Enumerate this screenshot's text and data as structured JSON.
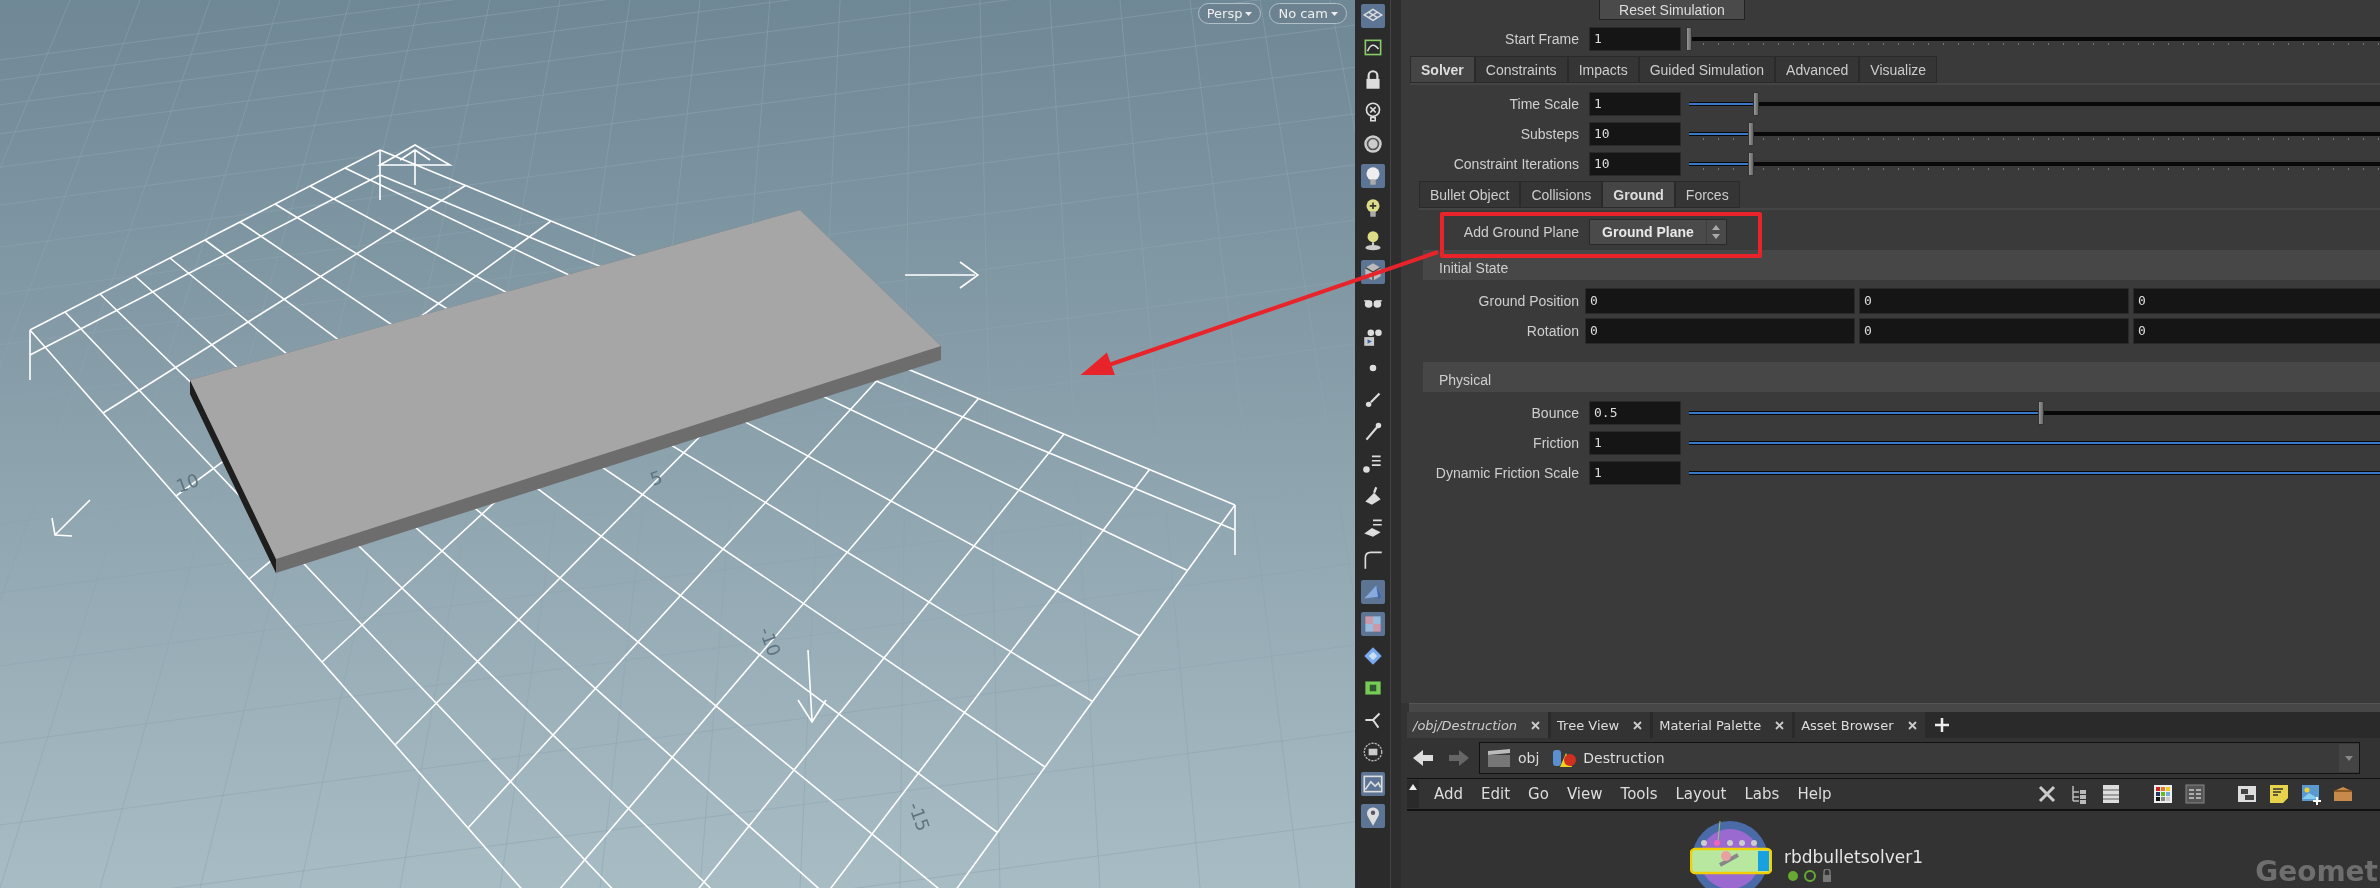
{
  "viewport": {
    "camera_buttons": [
      {
        "label": "Persp"
      },
      {
        "label": "No cam"
      }
    ],
    "grid_labels": [
      "10",
      "5",
      "-10",
      "-15"
    ]
  },
  "toolbar": {
    "tools": [
      {
        "on": true
      },
      {
        "on": false
      },
      {
        "on": false
      },
      {
        "on": false
      },
      {
        "on": false
      },
      {
        "on": true
      },
      {
        "on": false
      },
      {
        "on": false
      },
      {
        "on": true
      },
      {
        "on": false
      },
      {
        "on": false
      },
      {
        "on": false
      },
      {
        "on": false
      },
      {
        "on": false
      },
      {
        "on": false
      },
      {
        "on": false
      },
      {
        "on": false
      },
      {
        "on": false
      },
      {
        "on": true
      },
      {
        "on": true
      },
      {
        "on": false
      },
      {
        "on": false
      },
      {
        "on": false
      },
      {
        "on": false
      },
      {
        "on": true
      },
      {
        "on": true
      }
    ]
  },
  "parameters": {
    "reset_button": "Reset Simulation",
    "start_frame": {
      "kind": "int",
      "label": "Start Frame",
      "value": "1",
      "level": 0
    },
    "tabs": [
      {
        "label": "Solver",
        "selected": true
      },
      {
        "label": "Constraints",
        "selected": false
      },
      {
        "label": "Impacts",
        "selected": false
      },
      {
        "label": "Guided Simulation",
        "selected": false
      },
      {
        "label": "Advanced",
        "selected": false
      },
      {
        "label": "Visualize",
        "selected": false
      }
    ],
    "solver_params": [
      {
        "kind": "float",
        "label": "Time Scale",
        "value": "1",
        "level": 0.095
      },
      {
        "kind": "int",
        "label": "Substeps",
        "value": "10",
        "level": 0.088
      },
      {
        "kind": "int",
        "label": "Constraint Iterations",
        "value": "10",
        "level": 0.088
      }
    ],
    "subtabs": [
      {
        "label": "Bullet Object",
        "selected": false
      },
      {
        "label": "Collisions",
        "selected": false
      },
      {
        "label": "Ground",
        "selected": true
      },
      {
        "label": "Forces",
        "selected": false
      }
    ],
    "add_ground_plane": {
      "label": "Add Ground Plane",
      "value": "Ground Plane"
    },
    "sections": [
      {
        "title": "Initial State",
        "rows": [
          {
            "kind": "vector",
            "label": "Ground Position",
            "values": [
              "0",
              "0",
              "0"
            ]
          },
          {
            "kind": "vector",
            "label": "Rotation",
            "values": [
              "0",
              "0",
              "0"
            ]
          }
        ]
      },
      {
        "title": "Physical",
        "rows": [
          {
            "kind": "float",
            "label": "Bounce",
            "value": "0.5",
            "level": 0.5
          },
          {
            "kind": "float",
            "label": "Friction",
            "value": "1",
            "level": 1
          },
          {
            "kind": "float",
            "label": "Dynamic Friction Scale",
            "value": "1",
            "level": 1
          }
        ]
      }
    ]
  },
  "network": {
    "tabs": [
      {
        "label": "/obj/Destruction",
        "selected": true
      },
      {
        "label": "Tree View",
        "selected": false
      },
      {
        "label": "Material Palette",
        "selected": false
      },
      {
        "label": "Asset Browser",
        "selected": false
      }
    ],
    "path": [
      "obj",
      "Destruction"
    ],
    "menu": [
      "Add",
      "Edit",
      "Go",
      "View",
      "Tools",
      "Layout",
      "Labs",
      "Help"
    ],
    "node": {
      "name": "rbdbulletsolver1"
    },
    "context_label": "Geomet"
  }
}
